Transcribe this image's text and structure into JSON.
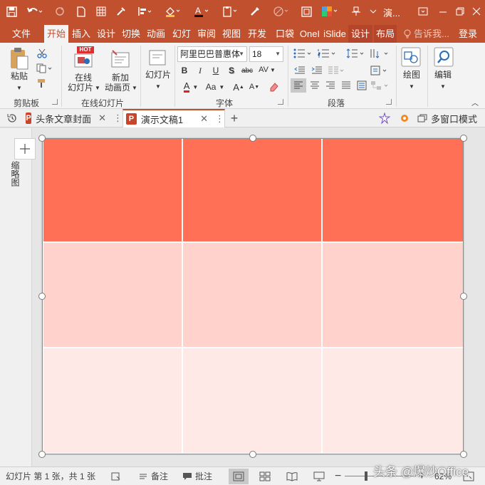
{
  "titlebar": {
    "title": "演..."
  },
  "tabs": [
    {
      "label": "文件",
      "active": false
    },
    {
      "label": "开始",
      "active": true
    },
    {
      "label": "插入",
      "active": false
    },
    {
      "label": "设计",
      "active": false
    },
    {
      "label": "切换",
      "active": false
    },
    {
      "label": "动画",
      "active": false
    },
    {
      "label": "幻灯",
      "active": false
    },
    {
      "label": "审阅",
      "active": false
    },
    {
      "label": "视图",
      "active": false
    },
    {
      "label": "开发",
      "active": false
    },
    {
      "label": "口袋",
      "active": false
    },
    {
      "label": "OneI",
      "active": false
    },
    {
      "label": "iSlide",
      "active": false
    },
    {
      "label": "设计",
      "active": false,
      "context": true
    },
    {
      "label": "布局",
      "active": false,
      "context": true
    }
  ],
  "tell_me": "告诉我...",
  "login": "登录",
  "ribbon": {
    "clipboard": {
      "paste": "粘贴",
      "group": "剪贴板"
    },
    "online": {
      "hot_badge": "HOT",
      "online_slide_1": "在线",
      "online_slide_2": "幻灯片",
      "new_anim_1": "新加",
      "new_anim_2": "动画页",
      "group": "在线幻灯片"
    },
    "slides": {
      "label": "幻灯片"
    },
    "font": {
      "name": "阿里巴巴普惠体",
      "size": "18",
      "bold": "B",
      "italic": "I",
      "underline": "U",
      "shadow": "S",
      "strike": "abc",
      "spacing": "AV",
      "font_color": "A",
      "change_case": "Aa",
      "grow": "A",
      "shrink": "A",
      "group": "字体"
    },
    "paragraph": {
      "group": "段落"
    },
    "drawing": {
      "label": "绘图"
    },
    "editing": {
      "label": "编辑"
    }
  },
  "doc_tabs": [
    {
      "label": "头条文章封面",
      "active": false
    },
    {
      "label": "演示文稿1",
      "active": true
    }
  ],
  "doc_tab_icon": "P",
  "multi_window": "多窗口模式",
  "left_pane": {
    "label": "缩略图"
  },
  "table": {
    "rows": 3,
    "cols": 3,
    "row_colors": [
      "#ff7057",
      "#ffd3cc",
      "#ffe9e6"
    ]
  },
  "status": {
    "slide_info": "幻灯片 第 1 张，共 1 张",
    "notes": "备注",
    "comments": "批注",
    "zoom_minus": "−",
    "zoom_plus": "+",
    "zoom": "62%"
  },
  "watermark": "头条 @爆炒Office",
  "colors": {
    "accent": "#c1502e",
    "ribbon_bg": "#f3f3f3",
    "canvas_bg": "#e6e6e6"
  }
}
